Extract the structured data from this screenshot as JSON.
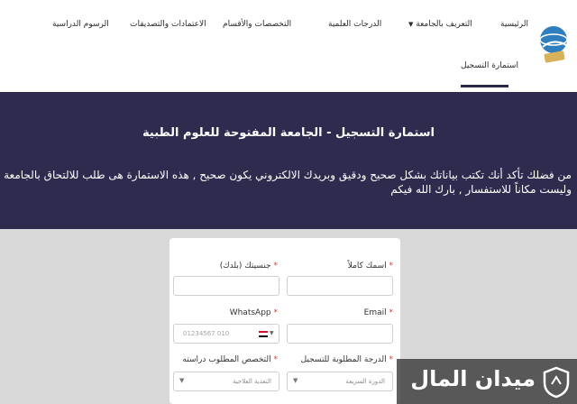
{
  "nav": {
    "items": [
      {
        "label": "الرئيسية"
      },
      {
        "label": "التعريف بالجامعة"
      },
      {
        "label": "الدرجات العلمية"
      },
      {
        "label": "التخصصات والأقسام"
      },
      {
        "label": "الاعتمادات والتصديقات"
      },
      {
        "label": "الرسوم الدراسية"
      }
    ],
    "active_item": "استمارة التسجيل",
    "caret": "▼"
  },
  "banner": {
    "title": "استمارة التسجيل - الجامعة المفتوحة للعلوم الطبية",
    "description": "من فضلك تأكد أنك تكتب بياناتك بشكل صحيح ودقيق وبريدك الالكتروني يكون صحيح , هذه الاستمارة هى طلب للالتحاق بالجامعة وليست مكاناً للاستفسار , بارك الله فيكم"
  },
  "form": {
    "name_label": "اسمك كاملاً",
    "nationality_label": "جنسيتك (بلدك)",
    "email_label": "Email",
    "whatsapp_label": "WhatsApp",
    "phone_placeholder": "010 01234567",
    "degree_label": "الدرجة المطلوبة للتسجيل",
    "degree_value": "الدورة السريعة",
    "specialty_label": "التخصص المطلوب دراسته",
    "specialty_value": "التغذية العلاجية",
    "required_mark": "*"
  },
  "watermark": {
    "text": "ميدان المال"
  },
  "colors": {
    "banner_bg": "#2e2b4f",
    "required": "#e0312b",
    "page_bg": "#d9d9d9"
  }
}
